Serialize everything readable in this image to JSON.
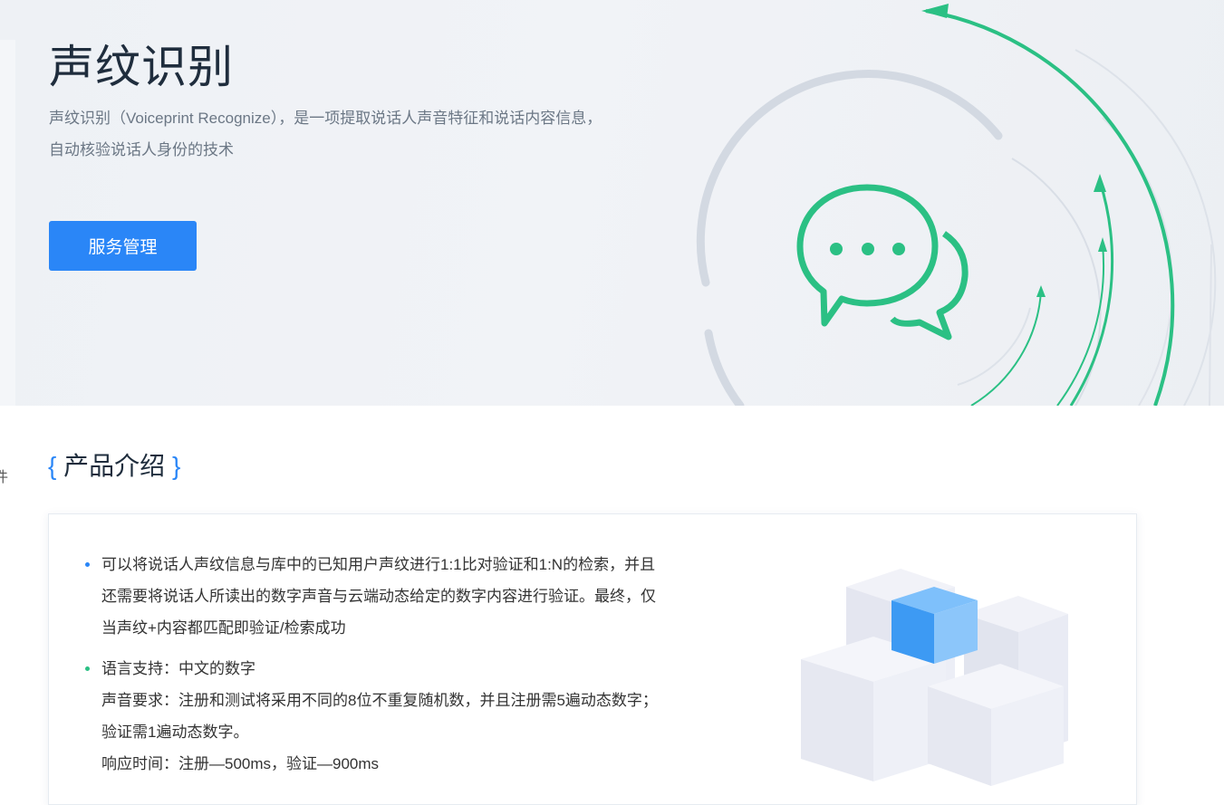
{
  "hero": {
    "title": "声纹识别",
    "description": "声纹识别（Voiceprint Recognize），是一项提取说话人声音特征和说话内容信息，自动核验说话人身份的技术",
    "button_label": "服务管理"
  },
  "sidebar": {
    "partial_text": "件"
  },
  "section": {
    "brace_open": "{",
    "title": "产品介绍",
    "brace_close": "}"
  },
  "features": [
    {
      "text": "可以将说话人声纹信息与库中的已知用户声纹进行1:1比对验证和1:N的检索，并且还需要将说话人所读出的数字声音与云端动态给定的数字内容进行验证。最终，仅当声纹+内容都匹配即验证/检索成功"
    },
    {
      "line1": "语言支持：中文的数字",
      "line2": "声音要求：注册和测试将采用不同的8位不重复随机数，并且注册需5遍动态数字；验证需1遍动态数字。",
      "line3": "响应时间：注册—500ms，验证—900ms"
    }
  ],
  "colors": {
    "accent_blue": "#2a86f7",
    "accent_green": "#2bc084",
    "title_dark": "#1f2d3d"
  },
  "icons": {
    "hero_icon": "chat-bubbles-icon",
    "illustration": "stacked-cubes-illustration"
  }
}
